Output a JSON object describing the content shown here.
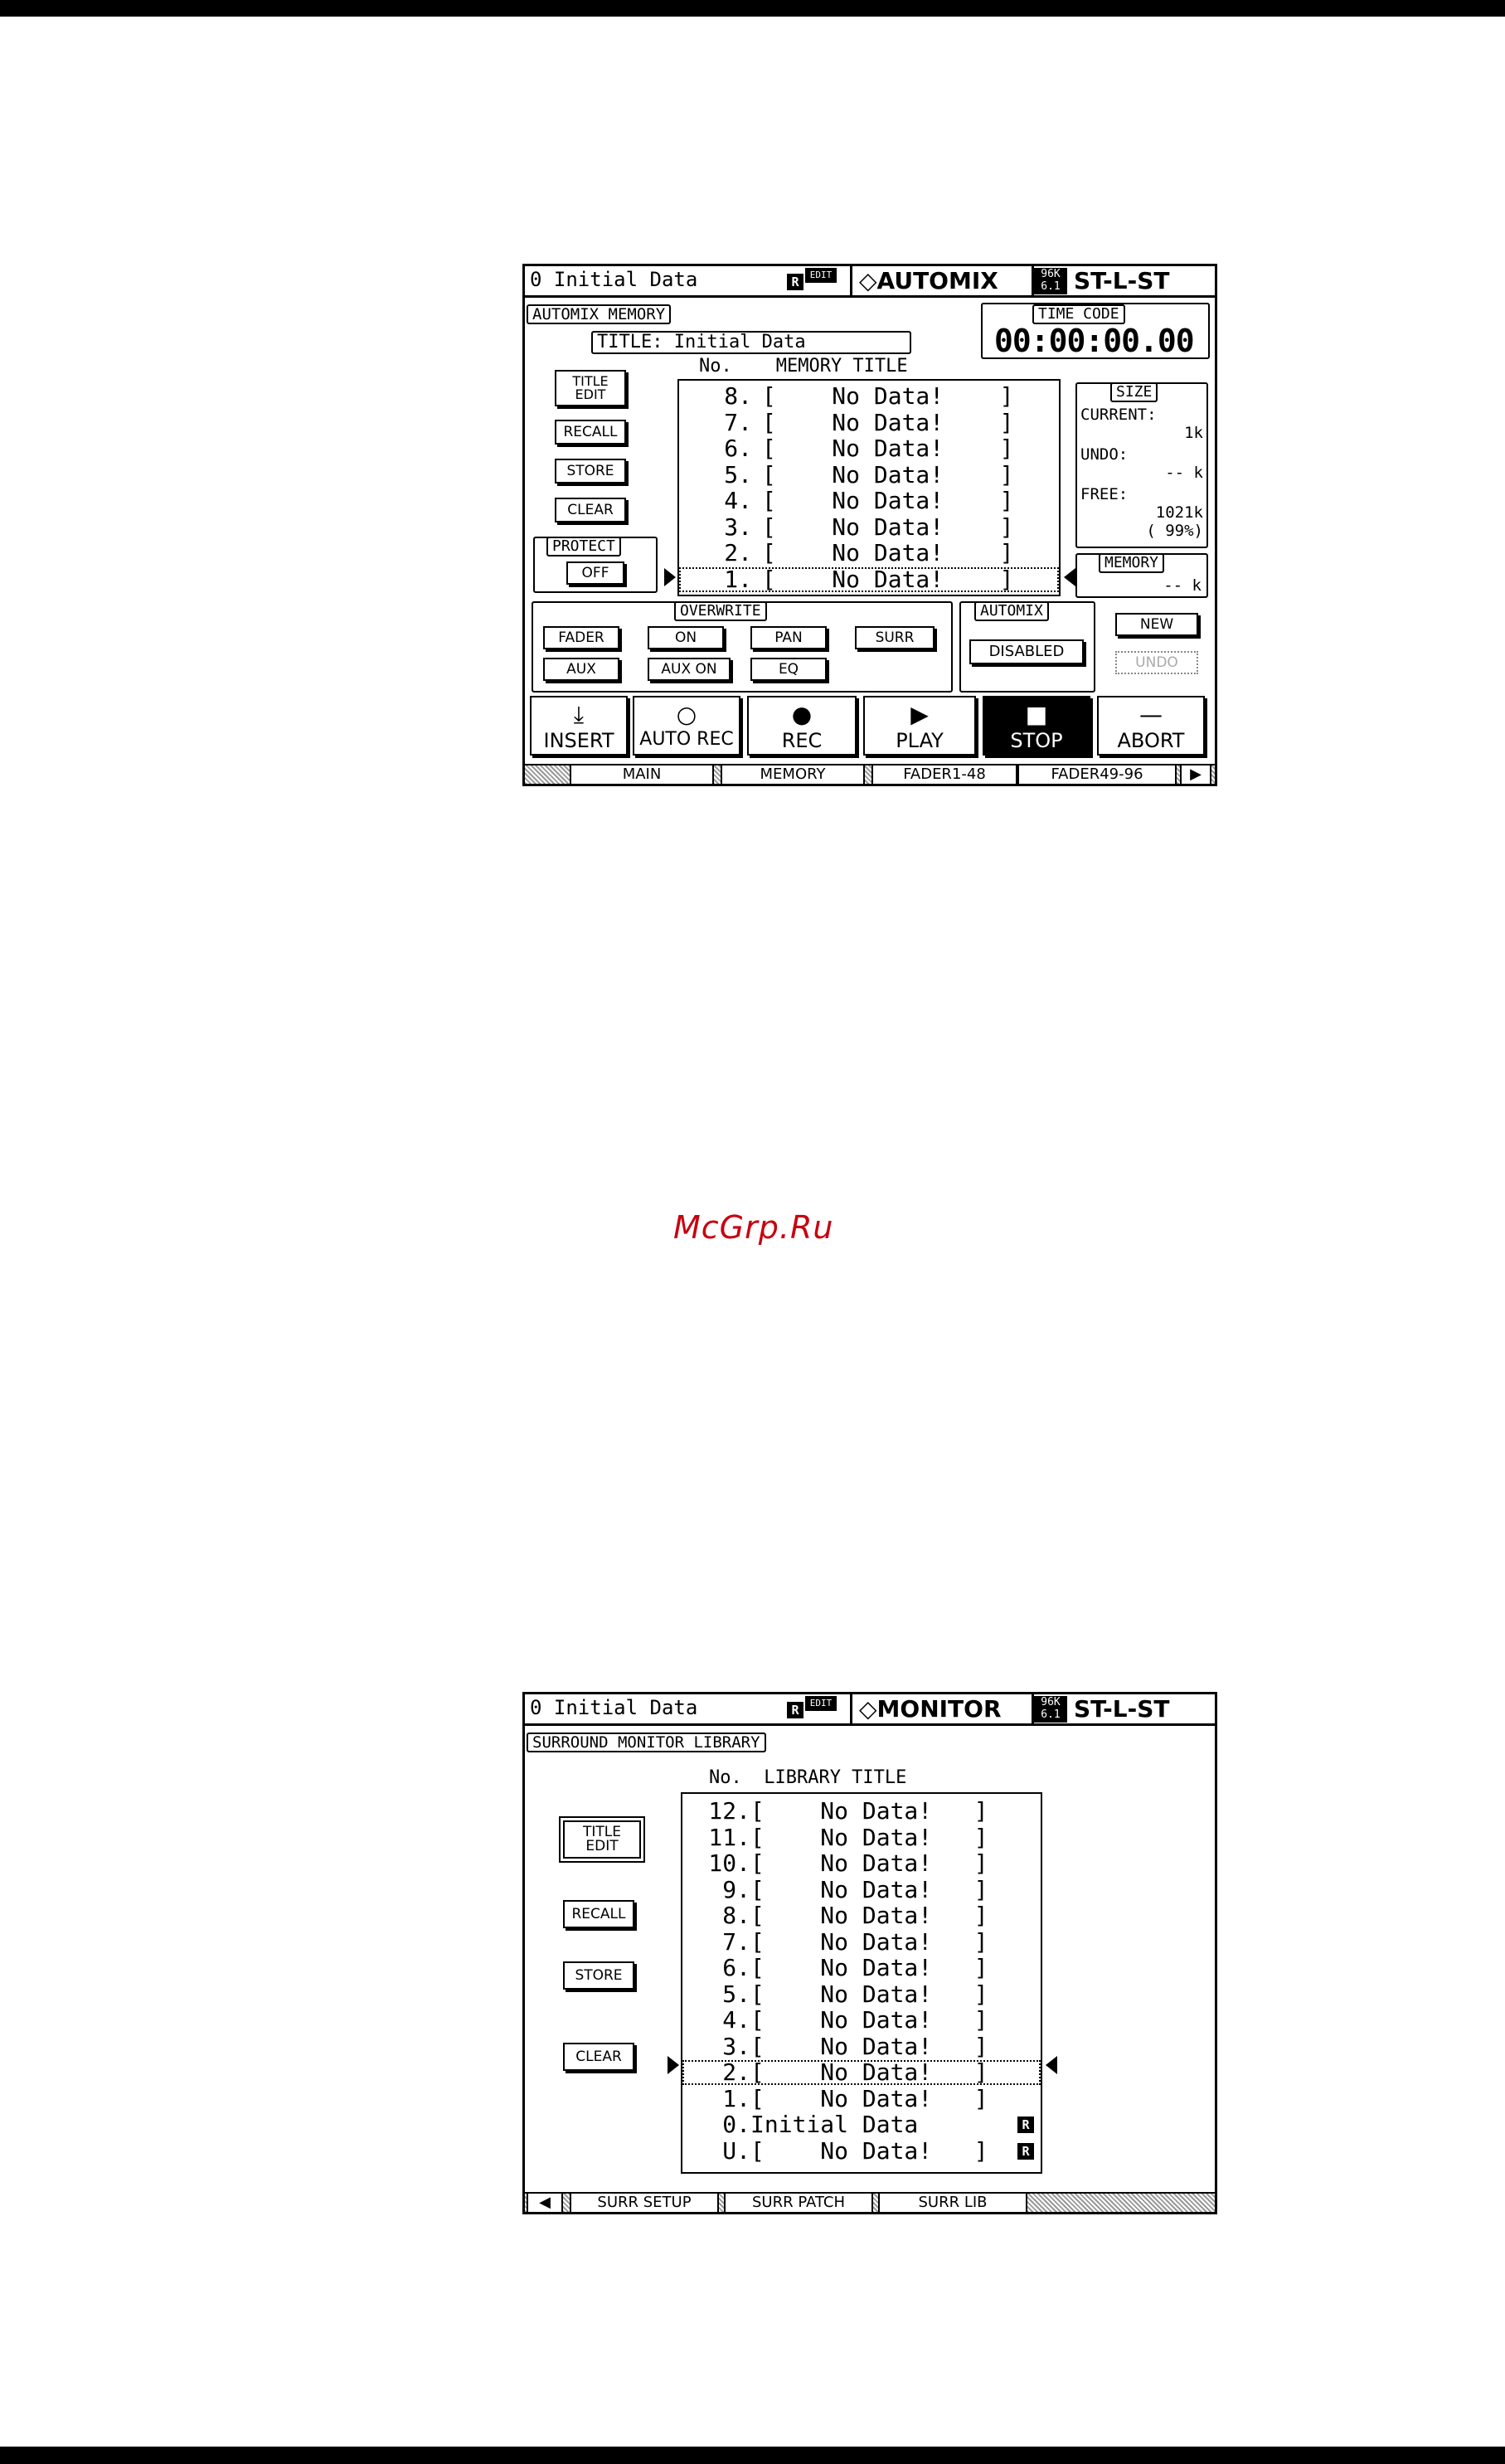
{
  "watermark": "McGrp.Ru",
  "automix_screen": {
    "header": {
      "scene": "0 Initial Data",
      "r_badge": "R",
      "edit_badge": "EDIT",
      "title": "◇AUTOMIX",
      "rate_top": "96K",
      "rate_bottom": "6.1",
      "bus": "ST-L-ST"
    },
    "section_title": "AUTOMIX MEMORY",
    "title_field": "TITLE: Initial Data",
    "time_code_label": "TIME CODE",
    "time_code_value": "00:00:00.00",
    "list_header": "No.    MEMORY TITLE",
    "buttons": {
      "title_edit_1": "TITLE",
      "title_edit_2": "EDIT",
      "recall": "RECALL",
      "store": "STORE",
      "clear": "CLEAR"
    },
    "protect": {
      "label": "PROTECT",
      "value": "OFF"
    },
    "rows": [
      {
        "no": "8.",
        "text": "[    No Data!    ]"
      },
      {
        "no": "7.",
        "text": "[    No Data!    ]"
      },
      {
        "no": "6.",
        "text": "[    No Data!    ]"
      },
      {
        "no": "5.",
        "text": "[    No Data!    ]"
      },
      {
        "no": "4.",
        "text": "[    No Data!    ]"
      },
      {
        "no": "3.",
        "text": "[    No Data!    ]"
      },
      {
        "no": "2.",
        "text": "[    No Data!    ]"
      },
      {
        "no": "1.",
        "text": "[    No Data!    ]"
      }
    ],
    "size": {
      "label": "SIZE",
      "current_label": "CURRENT:",
      "current_value": "1k",
      "undo_label": "UNDO:",
      "undo_value": "-- k",
      "free_label": "FREE:",
      "free_value": "1021k",
      "free_pct": "( 99%)"
    },
    "memory": {
      "label": "MEMORY",
      "value": "-- k"
    },
    "overwrite": {
      "label": "OVERWRITE",
      "fader": "FADER",
      "on": "ON",
      "pan": "PAN",
      "surr": "SURR",
      "aux": "AUX",
      "aux_on": "AUX ON",
      "eq": "EQ"
    },
    "automix": {
      "label": "AUTOMIX",
      "value": "DISABLED"
    },
    "new": "NEW",
    "undo": "UNDO",
    "transport": {
      "insert": "INSERT",
      "auto_rec": "AUTO REC",
      "rec": "REC",
      "play": "PLAY",
      "stop": "STOP",
      "abort": "ABORT"
    },
    "tabs": {
      "main": "MAIN",
      "memory": "MEMORY",
      "fader1": "FADER1-48",
      "fader2": "FADER49-96",
      "next": "▶"
    }
  },
  "monitor_screen": {
    "header": {
      "scene": "0 Initial Data",
      "r_badge": "R",
      "edit_badge": "EDIT",
      "title": "◇MONITOR",
      "rate_top": "96K",
      "rate_bottom": "6.1",
      "bus": "ST-L-ST"
    },
    "section_title": "SURROUND MONITOR LIBRARY",
    "list_header": "No.  LIBRARY TITLE",
    "buttons": {
      "title_edit_1": "TITLE",
      "title_edit_2": "EDIT",
      "recall": "RECALL",
      "store": "STORE",
      "clear": "CLEAR"
    },
    "rows": [
      {
        "no": "12.",
        "text": "[    No Data!   ]"
      },
      {
        "no": "11.",
        "text": "[    No Data!   ]"
      },
      {
        "no": "10.",
        "text": "[    No Data!   ]"
      },
      {
        "no": " 9.",
        "text": "[    No Data!   ]"
      },
      {
        "no": " 8.",
        "text": "[    No Data!   ]"
      },
      {
        "no": " 7.",
        "text": "[    No Data!   ]"
      },
      {
        "no": " 6.",
        "text": "[    No Data!   ]"
      },
      {
        "no": " 5.",
        "text": "[    No Data!   ]"
      },
      {
        "no": " 4.",
        "text": "[    No Data!   ]"
      },
      {
        "no": " 3.",
        "text": "[    No Data!   ]"
      },
      {
        "no": " 2.",
        "text": "[    No Data!   ]"
      },
      {
        "no": " 1.",
        "text": "[    No Data!   ]"
      },
      {
        "no": " 0.",
        "text": "Initial Data"
      },
      {
        "no": " U.",
        "text": "[    No Data!   ]"
      }
    ],
    "r_tag": "R",
    "tabs": {
      "prev": "◀",
      "surr_setup": "SURR SETUP",
      "surr_patch": "SURR PATCH",
      "surr_lib": "SURR LIB"
    }
  }
}
